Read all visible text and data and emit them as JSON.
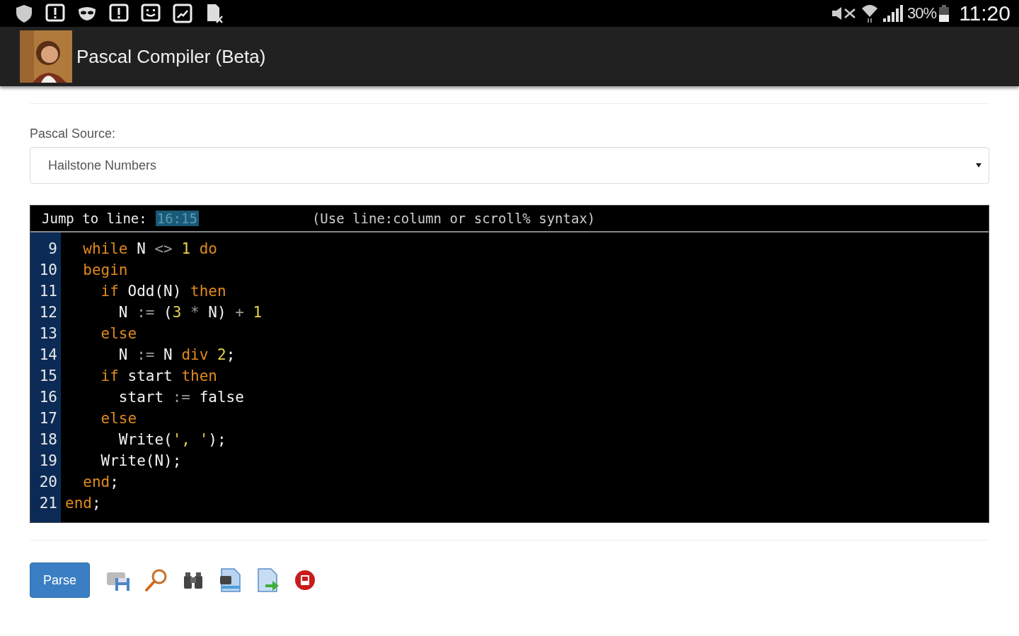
{
  "status_bar": {
    "battery": "30%",
    "time": "11:20"
  },
  "app_bar": {
    "title": "Pascal Compiler (Beta)"
  },
  "source": {
    "label": "Pascal Source:",
    "value": "Hailstone Numbers"
  },
  "editor": {
    "jump_label": "Jump to line:",
    "jump_value": "16:15",
    "jump_hint": "(Use line:column or scroll% syntax)",
    "lines": [
      {
        "number": "9",
        "tokens": [
          {
            "kind": "kw",
            "text": "  while"
          },
          {
            "kind": "id",
            "text": " N "
          },
          {
            "kind": "op",
            "text": "<>"
          },
          {
            "kind": "num",
            "text": " 1"
          },
          {
            "kind": "kw",
            "text": " do"
          }
        ]
      },
      {
        "number": "10",
        "tokens": [
          {
            "kind": "kw",
            "text": "  begin"
          }
        ]
      },
      {
        "number": "11",
        "tokens": [
          {
            "kind": "kw",
            "text": "    if"
          },
          {
            "kind": "id",
            "text": " Odd(N)"
          },
          {
            "kind": "kw",
            "text": " then"
          }
        ]
      },
      {
        "number": "12",
        "tokens": [
          {
            "kind": "id",
            "text": "      N "
          },
          {
            "kind": "op",
            "text": ":="
          },
          {
            "kind": "id",
            "text": " ("
          },
          {
            "kind": "num",
            "text": "3"
          },
          {
            "kind": "op",
            "text": " * "
          },
          {
            "kind": "id",
            "text": "N) "
          },
          {
            "kind": "op",
            "text": "+"
          },
          {
            "kind": "num",
            "text": " 1"
          }
        ]
      },
      {
        "number": "13",
        "tokens": [
          {
            "kind": "kw",
            "text": "    else"
          }
        ]
      },
      {
        "number": "14",
        "tokens": [
          {
            "kind": "id",
            "text": "      N "
          },
          {
            "kind": "op",
            "text": ":="
          },
          {
            "kind": "id",
            "text": " N "
          },
          {
            "kind": "kw",
            "text": "div"
          },
          {
            "kind": "num",
            "text": " 2"
          },
          {
            "kind": "id",
            "text": ";"
          }
        ]
      },
      {
        "number": "15",
        "tokens": [
          {
            "kind": "kw",
            "text": "    if"
          },
          {
            "kind": "id",
            "text": " start "
          },
          {
            "kind": "kw",
            "text": "then"
          }
        ]
      },
      {
        "number": "16",
        "tokens": [
          {
            "kind": "id",
            "text": "      start "
          },
          {
            "kind": "op",
            "text": ":="
          },
          {
            "kind": "id",
            "text": " false"
          }
        ]
      },
      {
        "number": "17",
        "tokens": [
          {
            "kind": "kw",
            "text": "    else"
          }
        ]
      },
      {
        "number": "18",
        "tokens": [
          {
            "kind": "id",
            "text": "      Write("
          },
          {
            "kind": "str",
            "text": "', '"
          },
          {
            "kind": "id",
            "text": ");"
          }
        ]
      },
      {
        "number": "19",
        "tokens": [
          {
            "kind": "id",
            "text": "    Write(N);"
          }
        ]
      },
      {
        "number": "20",
        "tokens": [
          {
            "kind": "kw",
            "text": "  end"
          },
          {
            "kind": "id",
            "text": ";"
          }
        ]
      },
      {
        "number": "21",
        "tokens": [
          {
            "kind": "kw",
            "text": "end"
          },
          {
            "kind": "id",
            "text": ";"
          }
        ]
      }
    ]
  },
  "actions": {
    "parse": "Parse"
  }
}
